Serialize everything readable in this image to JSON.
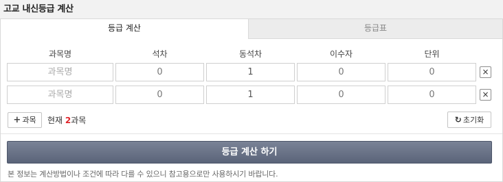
{
  "title": "고교 내신등급 계산",
  "tabs": [
    {
      "label": "등급 계산",
      "active": true
    },
    {
      "label": "등급표",
      "active": false
    }
  ],
  "columns": [
    "과목명",
    "석차",
    "동석차",
    "이수자",
    "단위"
  ],
  "rows": [
    {
      "subject_placeholder": "과목명",
      "rank": "0",
      "tied_rank": "1",
      "students": "0",
      "units": "0"
    },
    {
      "subject_placeholder": "과목명",
      "rank": "0",
      "tied_rank": "1",
      "students": "0",
      "units": "0"
    }
  ],
  "delete_label": "×",
  "add_button": {
    "icon": "plus-icon",
    "label": "과목"
  },
  "status": {
    "prefix": "현재 ",
    "count": "2",
    "suffix": "과목"
  },
  "reset_button": {
    "icon": "refresh-icon",
    "label": "초기화"
  },
  "calc_button": "등급 계산 하기",
  "notice": "본 정보는 계산방법이나 조건에 따라 다를 수 있으니 참고용으로만 사용하시기 바랍니다.",
  "colors": {
    "accent_count": "#e0242a",
    "button_bg": "#5a6479"
  }
}
